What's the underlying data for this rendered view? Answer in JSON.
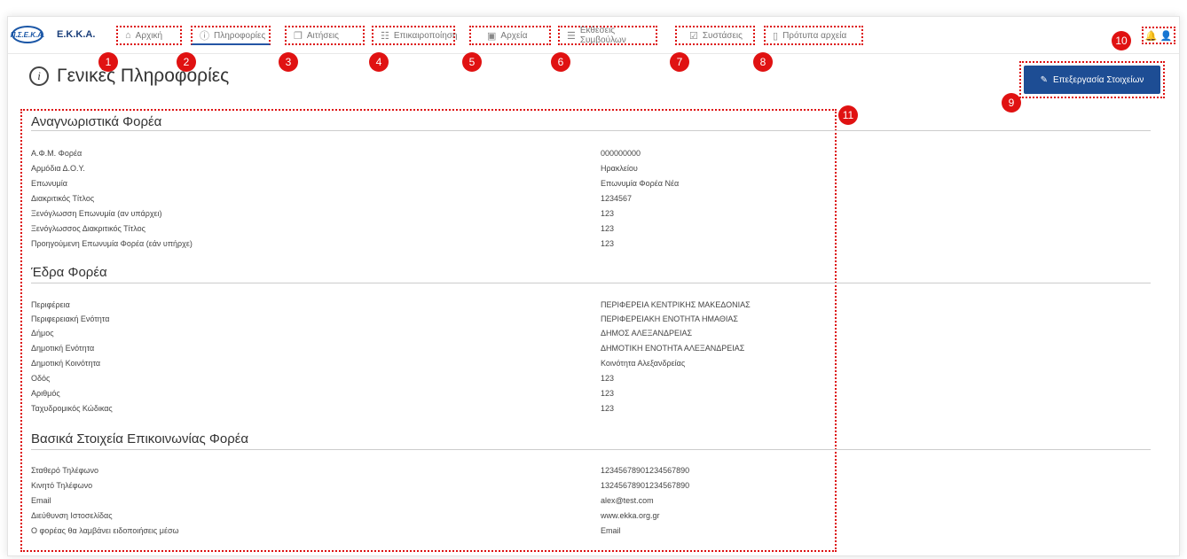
{
  "brand": {
    "logo_text": "Π.Σ.Ε.Κ.Α.",
    "name": "Ε.Κ.Κ.Α."
  },
  "nav": [
    {
      "label": "Αρχική",
      "icon": "home-icon",
      "glyph": "⌂",
      "badge": "1"
    },
    {
      "label": "Πληροφορίες",
      "icon": "info-icon",
      "glyph": "ⓘ",
      "badge": "2"
    },
    {
      "label": "Αιτήσεις",
      "icon": "document-icon",
      "glyph": "❐",
      "badge": "3"
    },
    {
      "label": "Επικαιροποίηση",
      "icon": "calendar-icon",
      "glyph": "☷",
      "badge": "4"
    },
    {
      "label": "Αρχεία",
      "icon": "folder-icon",
      "glyph": "▣",
      "badge": "5"
    },
    {
      "label": "Εκθέσεις Συμβούλων",
      "icon": "report-icon",
      "glyph": "☰",
      "badge": "6"
    },
    {
      "label": "Συστάσεις",
      "icon": "checklist-icon",
      "glyph": "☑",
      "badge": "7"
    },
    {
      "label": "Πρότυπα αρχεία",
      "icon": "file-icon",
      "glyph": "▯",
      "badge": "8"
    }
  ],
  "top_icons": {
    "badge": "10",
    "bell": "🔔",
    "user": "👤"
  },
  "page_title": "Γενικές Πληροφορίες",
  "edit_button": {
    "label": "Επεξεργασία Στοιχείων",
    "badge": "9",
    "glyph": "✎"
  },
  "content_badge": "11",
  "sections": [
    {
      "title": "Αναγνωριστικά Φορέα",
      "rows": [
        {
          "label": "Α.Φ.Μ. Φορέα",
          "value": "000000000"
        },
        {
          "label": "Αρμόδια Δ.Ο.Υ.",
          "value": "Ηρακλείου"
        },
        {
          "label": "Επωνυμία",
          "value": "Επωνυμία Φορέα Νέα"
        },
        {
          "label": "Διακριτικός Τίτλος",
          "value": "1234567"
        },
        {
          "label": "Ξενόγλωσση Επωνυμία (αν υπάρχει)",
          "value": "123"
        },
        {
          "label": "Ξενόγλωσσος Διακριτικός Τίτλος",
          "value": "123"
        },
        {
          "label": "Προηγούμενη Επωνυμία Φορέα (εάν υπήρχε)",
          "value": "123"
        }
      ]
    },
    {
      "title": "Έδρα Φορέα",
      "rows": [
        {
          "label": "Περιφέρεια",
          "value": "ΠΕΡΙΦΕΡΕΙΑ ΚΕΝΤΡΙΚΗΣ ΜΑΚΕΔΟΝΙΑΣ"
        },
        {
          "label": "Περιφερειακή Ενότητα",
          "value": "ΠΕΡΙΦΕΡΕΙΑΚΗ ΕΝΟΤΗΤΑ ΗΜΑΘΙΑΣ"
        },
        {
          "label": "Δήμος",
          "value": "ΔΗΜΟΣ ΑΛΕΞΑΝΔΡΕΙΑΣ"
        },
        {
          "label": "Δημοτική Ενότητα",
          "value": "ΔΗΜΟΤΙΚΗ ΕΝΟΤΗΤΑ ΑΛΕΞΑΝΔΡΕΙΑΣ"
        },
        {
          "label": "Δημοτική Κοινότητα",
          "value": "Κοινότητα Αλεξανδρείας"
        },
        {
          "label": "Οδός",
          "value": "123"
        },
        {
          "label": "Αριθμός",
          "value": "123"
        },
        {
          "label": "Ταχυδρομικός Κώδικας",
          "value": "123"
        }
      ]
    },
    {
      "title": "Βασικά Στοιχεία Επικοινωνίας Φορέα",
      "rows": [
        {
          "label": "Σταθερό Τηλέφωνο",
          "value": "12345678901234567890"
        },
        {
          "label": "Κινητό Τηλέφωνο",
          "value": "13245678901234567890"
        },
        {
          "label": "Email",
          "value": "alex@test.com"
        },
        {
          "label": "Διεύθυνση Ιστοσελίδας",
          "value": "www.ekka.org.gr"
        },
        {
          "label": "Ο φορέας θα λαμβάνει ειδοποιήσεις μέσω",
          "value": "Email"
        }
      ]
    }
  ],
  "colors": {
    "accent": "#1d4d94",
    "annotation": "#e01212"
  }
}
